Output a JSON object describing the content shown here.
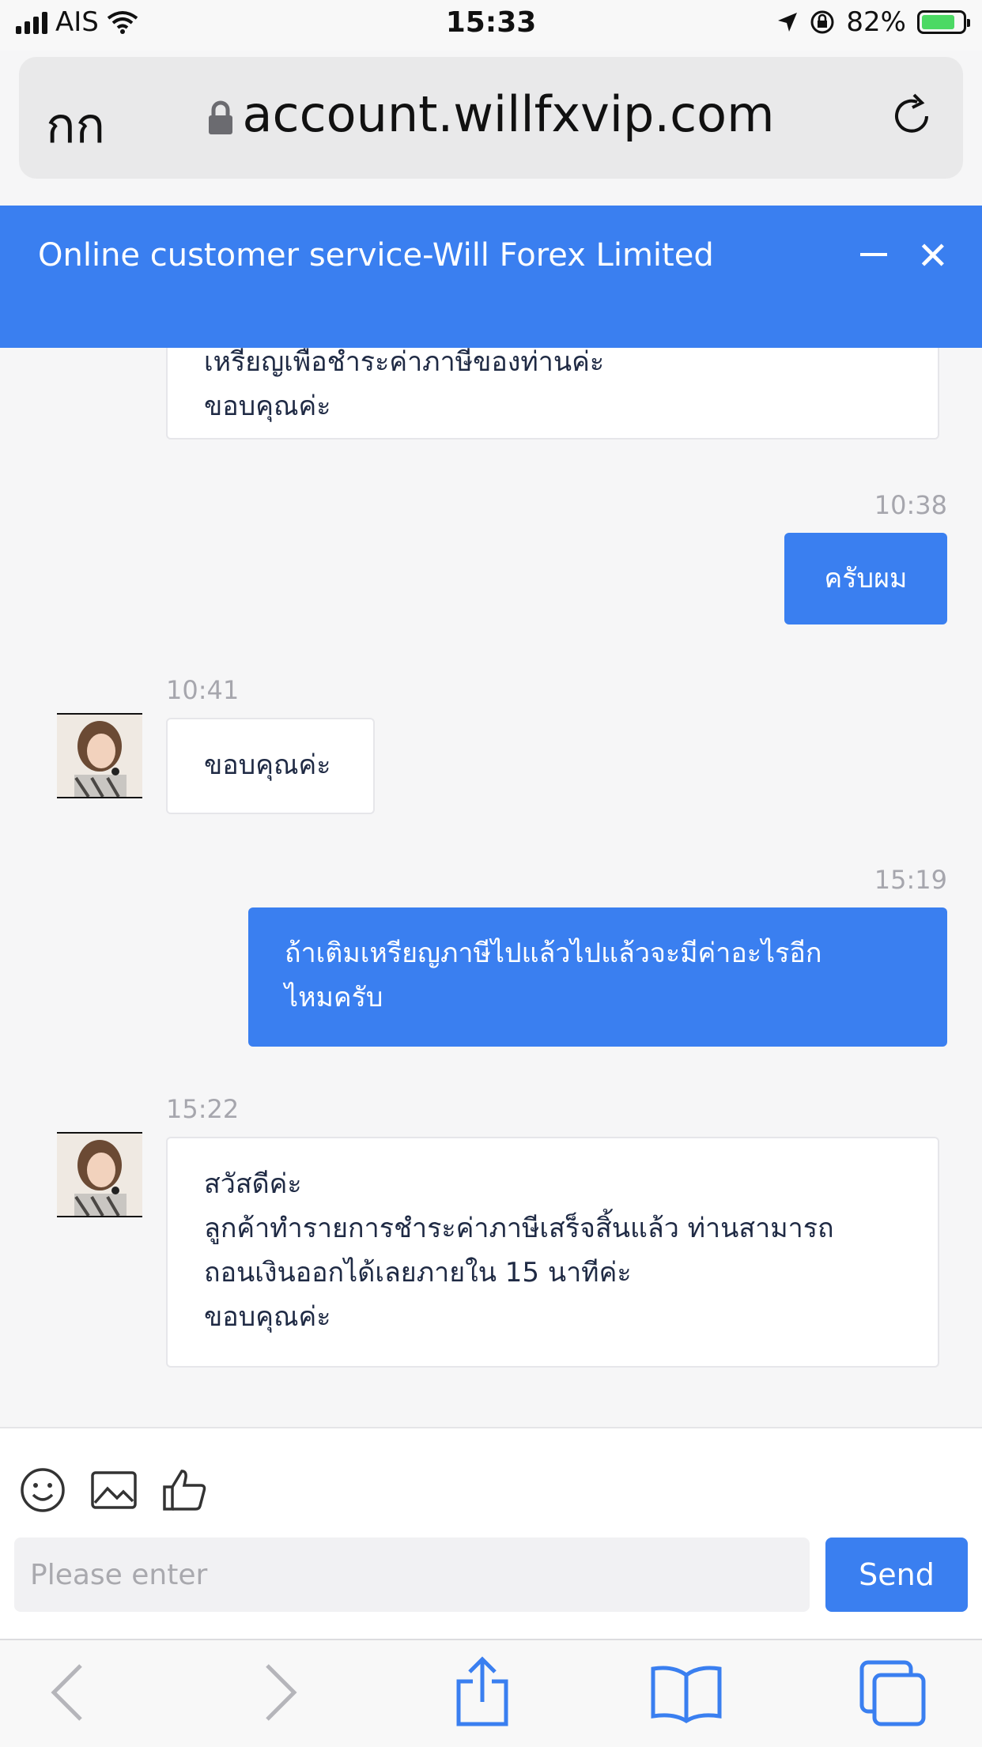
{
  "status_bar": {
    "carrier": "AIS",
    "time": "15:33",
    "battery_text": "82%",
    "battery_level": 0.82
  },
  "browser": {
    "text_size_label": "กก",
    "url": "account.willfxvip.com"
  },
  "chat_header": {
    "title": "Online customer service-Will Forex Limited"
  },
  "messages": [
    {
      "side": "left",
      "lines": [
        "เหรียญเพื่อชำระค่าภาษีของท่านค่ะ",
        "ขอบคุณค่ะ"
      ]
    },
    {
      "side": "right",
      "time": "10:38",
      "lines": [
        "ครับผม"
      ]
    },
    {
      "side": "left",
      "time": "10:41",
      "lines": [
        "ขอบคุณค่ะ"
      ]
    },
    {
      "side": "right",
      "time": "15:19",
      "lines": [
        "ถ้าเติมเหรียญภาษีไปแล้วไปแล้วจะมีค่าอะไรอีก",
        "ไหมครับ"
      ]
    },
    {
      "side": "left",
      "time": "15:22",
      "lines": [
        "สวัสดีค่ะ",
        "ลูกค้าทำรายการชำระค่าภาษีเสร็จสิ้นแล้ว ท่านสามารถ",
        "ถอนเงินออกได้เลยภายใน 15 นาทีค่ะ",
        "ขอบคุณค่ะ"
      ]
    }
  ],
  "composer": {
    "placeholder": "Please enter",
    "send_label": "Send"
  },
  "colors": {
    "brand_blue": "#3a7ff0"
  }
}
